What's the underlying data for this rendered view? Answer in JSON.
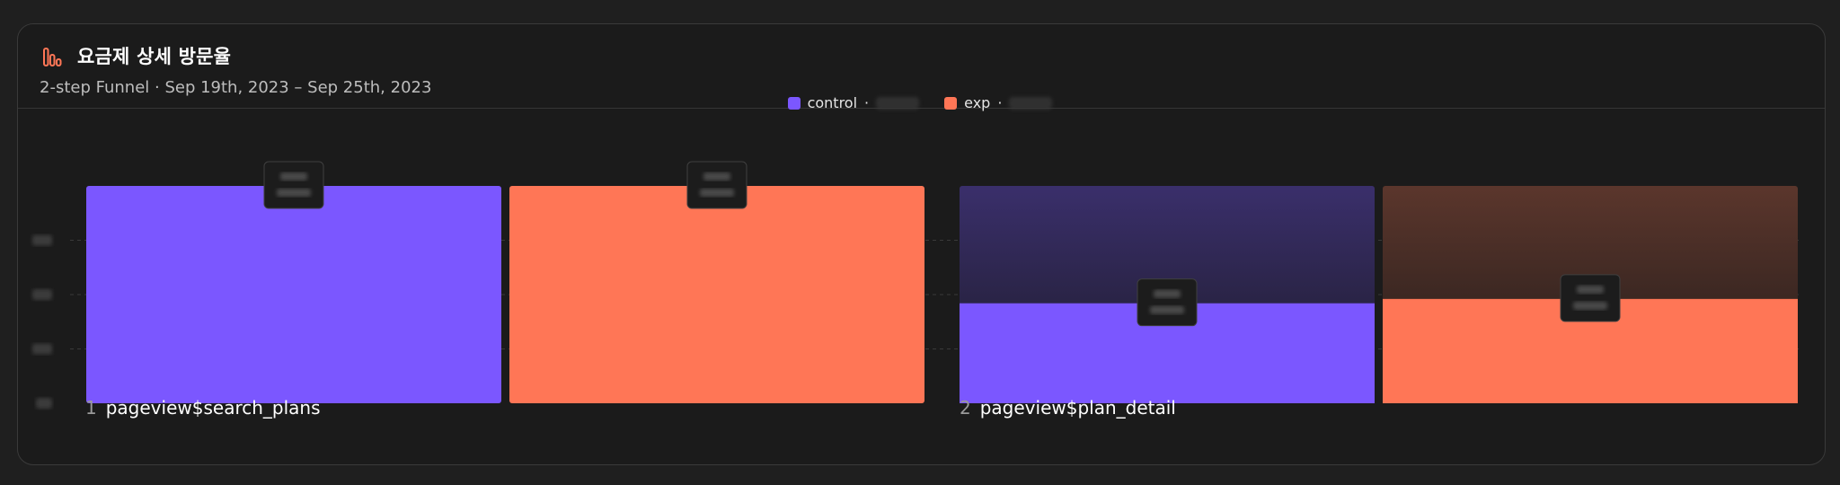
{
  "header": {
    "title": "요금제 상세 방문율",
    "subtitle": "2-step Funnel · Sep 19th, 2023 – Sep 25th, 2023",
    "icon": "bar-chart-icon"
  },
  "colors": {
    "control": "#7b57ff",
    "exp": "#ff7656",
    "control_dropoff": "#3a2f6b",
    "exp_dropoff": "#5b362c"
  },
  "chart_data": {
    "type": "bar",
    "categories": [
      "pageview$search_plans",
      "pageview$plan_detail"
    ],
    "category_numbers": [
      "1",
      "2"
    ],
    "series": [
      {
        "name": "control",
        "values": [
          100,
          46
        ]
      },
      {
        "name": "exp",
        "values": [
          100,
          48
        ]
      }
    ],
    "ylim": [
      0,
      100
    ],
    "grid": true,
    "legend_position": "top-center"
  }
}
